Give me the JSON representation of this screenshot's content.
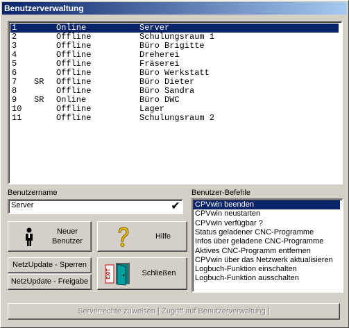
{
  "window": {
    "title": "Benutzerverwaltung"
  },
  "users": {
    "rows": [
      {
        "num": "1",
        "flag": "",
        "status": "Online",
        "name": "Server"
      },
      {
        "num": "2",
        "flag": "",
        "status": "Offline",
        "name": "Schulungsraum 1"
      },
      {
        "num": "3",
        "flag": "",
        "status": "Offline",
        "name": "Büro Brigitte"
      },
      {
        "num": "4",
        "flag": "",
        "status": "Offline",
        "name": "Dreherei"
      },
      {
        "num": "5",
        "flag": "",
        "status": "Offline",
        "name": "Fräserei"
      },
      {
        "num": "6",
        "flag": "",
        "status": "Offline",
        "name": "Büro Werkstatt"
      },
      {
        "num": "7",
        "flag": "SR",
        "status": "Offline",
        "name": "Büro Dieter"
      },
      {
        "num": "8",
        "flag": "",
        "status": "Offline",
        "name": "Büro Sandra"
      },
      {
        "num": "9",
        "flag": "SR",
        "status": "Online",
        "name": "Büro DWC"
      },
      {
        "num": "10",
        "flag": "",
        "status": "Offline",
        "name": "Lager"
      },
      {
        "num": "11",
        "flag": "",
        "status": "Offline",
        "name": "Schulungsraum 2"
      }
    ]
  },
  "username": {
    "label": "Benutzername",
    "value": "Server"
  },
  "commands": {
    "label": "Benutzer-Befehle",
    "items": [
      "CPVwin beenden",
      "CPVwin neustarten",
      "CPVwin verfügbar ?",
      "Status geladener CNC-Programme",
      "Infos über geladene CNC-Programme",
      "Aktives CNC-Programm entfernen",
      "CPVwin über das Netzwerk aktualisieren",
      "Logbuch-Funktion einschalten",
      "Logbuch-Funktion ausschalten"
    ]
  },
  "buttons": {
    "new_user": "Neuer\nBenutzer",
    "help": "Hilfe",
    "netupdate_lock": "NetzUpdate - Sperren",
    "netupdate_release": "NetzUpdate - Freigabe",
    "close": "Schließen",
    "exit_sign": "EXIT",
    "server_rights": "Serverrechte zuweisen [ Zugriff auf Benutzerverwaltung ]"
  },
  "colors": {
    "selection": "#0a246a",
    "face": "#d4d0c8",
    "help_icon": "#e8c000"
  }
}
